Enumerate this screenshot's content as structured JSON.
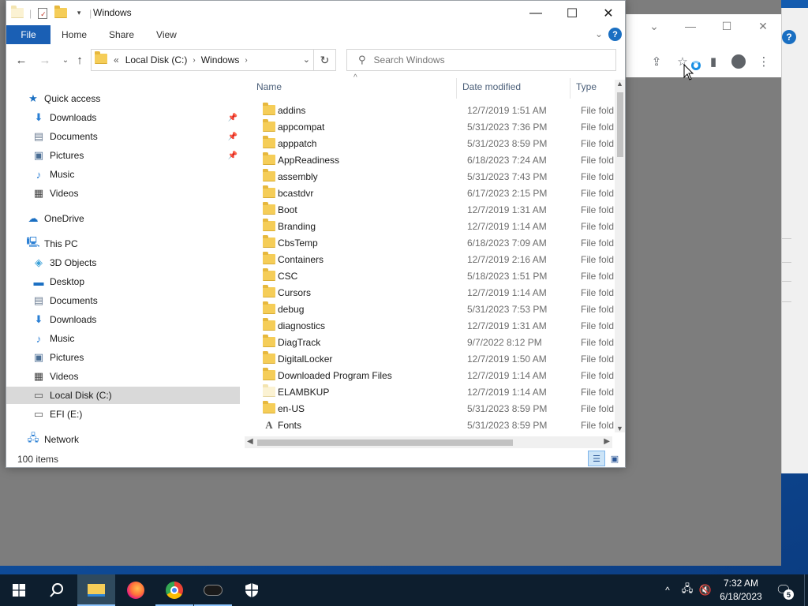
{
  "window": {
    "title": "Windows",
    "minimize_label": "—",
    "maximize_label": "☐",
    "close_label": "✕"
  },
  "ribbon": {
    "tabs": [
      "File",
      "Home",
      "Share",
      "View"
    ],
    "help": "?"
  },
  "address": {
    "prefix": "«",
    "crumbs": [
      "Local Disk (C:)",
      "Windows"
    ]
  },
  "search": {
    "placeholder": "Search Windows"
  },
  "nav": {
    "items": [
      {
        "label": "Quick access",
        "icon": "star-icon",
        "pinned": false
      },
      {
        "label": "Downloads",
        "icon": "downloads-icon",
        "pinned": true
      },
      {
        "label": "Documents",
        "icon": "documents-icon",
        "pinned": true
      },
      {
        "label": "Pictures",
        "icon": "pictures-icon",
        "pinned": true
      },
      {
        "label": "Music",
        "icon": "music-icon",
        "pinned": false
      },
      {
        "label": "Videos",
        "icon": "videos-icon",
        "pinned": false
      },
      {
        "label": "OneDrive",
        "icon": "onedrive-icon",
        "pinned": false
      },
      {
        "label": "This PC",
        "icon": "this-pc-icon",
        "pinned": false
      },
      {
        "label": "3D Objects",
        "icon": "3d-objects-icon",
        "pinned": false
      },
      {
        "label": "Desktop",
        "icon": "desktop-icon",
        "pinned": false
      },
      {
        "label": "Documents",
        "icon": "documents-icon",
        "pinned": false
      },
      {
        "label": "Downloads",
        "icon": "downloads-icon",
        "pinned": false
      },
      {
        "label": "Music",
        "icon": "music-icon",
        "pinned": false
      },
      {
        "label": "Pictures",
        "icon": "pictures-icon",
        "pinned": false
      },
      {
        "label": "Videos",
        "icon": "videos-icon",
        "pinned": false
      },
      {
        "label": "Local Disk (C:)",
        "icon": "local-disk-icon",
        "pinned": false,
        "selected": true
      },
      {
        "label": "EFI (E:)",
        "icon": "drive-icon",
        "pinned": false
      },
      {
        "label": "Network",
        "icon": "network-icon",
        "pinned": false
      }
    ]
  },
  "columns": {
    "name": "Name",
    "date": "Date modified",
    "type": "Type"
  },
  "files": [
    {
      "name": "addins",
      "date": "12/7/2019 1:51 AM",
      "type": "File folder"
    },
    {
      "name": "appcompat",
      "date": "5/31/2023 7:36 PM",
      "type": "File folder"
    },
    {
      "name": "apppatch",
      "date": "5/31/2023 8:59 PM",
      "type": "File folder"
    },
    {
      "name": "AppReadiness",
      "date": "6/18/2023 7:24 AM",
      "type": "File folder"
    },
    {
      "name": "assembly",
      "date": "5/31/2023 7:43 PM",
      "type": "File folder"
    },
    {
      "name": "bcastdvr",
      "date": "6/17/2023 2:15 PM",
      "type": "File folder"
    },
    {
      "name": "Boot",
      "date": "12/7/2019 1:31 AM",
      "type": "File folder"
    },
    {
      "name": "Branding",
      "date": "12/7/2019 1:14 AM",
      "type": "File folder"
    },
    {
      "name": "CbsTemp",
      "date": "6/18/2023 7:09 AM",
      "type": "File folder"
    },
    {
      "name": "Containers",
      "date": "12/7/2019 2:16 AM",
      "type": "File folder"
    },
    {
      "name": "CSC",
      "date": "5/18/2023 1:51 PM",
      "type": "File folder"
    },
    {
      "name": "Cursors",
      "date": "12/7/2019 1:14 AM",
      "type": "File folder"
    },
    {
      "name": "debug",
      "date": "5/31/2023 7:53 PM",
      "type": "File folder"
    },
    {
      "name": "diagnostics",
      "date": "12/7/2019 1:31 AM",
      "type": "File folder"
    },
    {
      "name": "DiagTrack",
      "date": "9/7/2022 8:12 PM",
      "type": "File folder"
    },
    {
      "name": "DigitalLocker",
      "date": "12/7/2019 1:50 AM",
      "type": "File folder"
    },
    {
      "name": "Downloaded Program Files",
      "date": "12/7/2019 1:14 AM",
      "type": "File folder"
    },
    {
      "name": "ELAMBKUP",
      "date": "12/7/2019 1:14 AM",
      "type": "File folder",
      "hidden": true
    },
    {
      "name": "en-US",
      "date": "5/31/2023 8:59 PM",
      "type": "File folder"
    },
    {
      "name": "Fonts",
      "date": "5/31/2023 8:59 PM",
      "type": "File folder",
      "special": "font"
    }
  ],
  "status": {
    "item_count": "100 items"
  },
  "taskbar": {
    "time": "7:32 AM",
    "date": "6/18/2023",
    "notification_count": "5"
  },
  "colors": {
    "accent": "#1a5fb4",
    "folder": "#f5cd58",
    "taskbar": "#0d1e2e",
    "selection": "#d9d9d9"
  }
}
